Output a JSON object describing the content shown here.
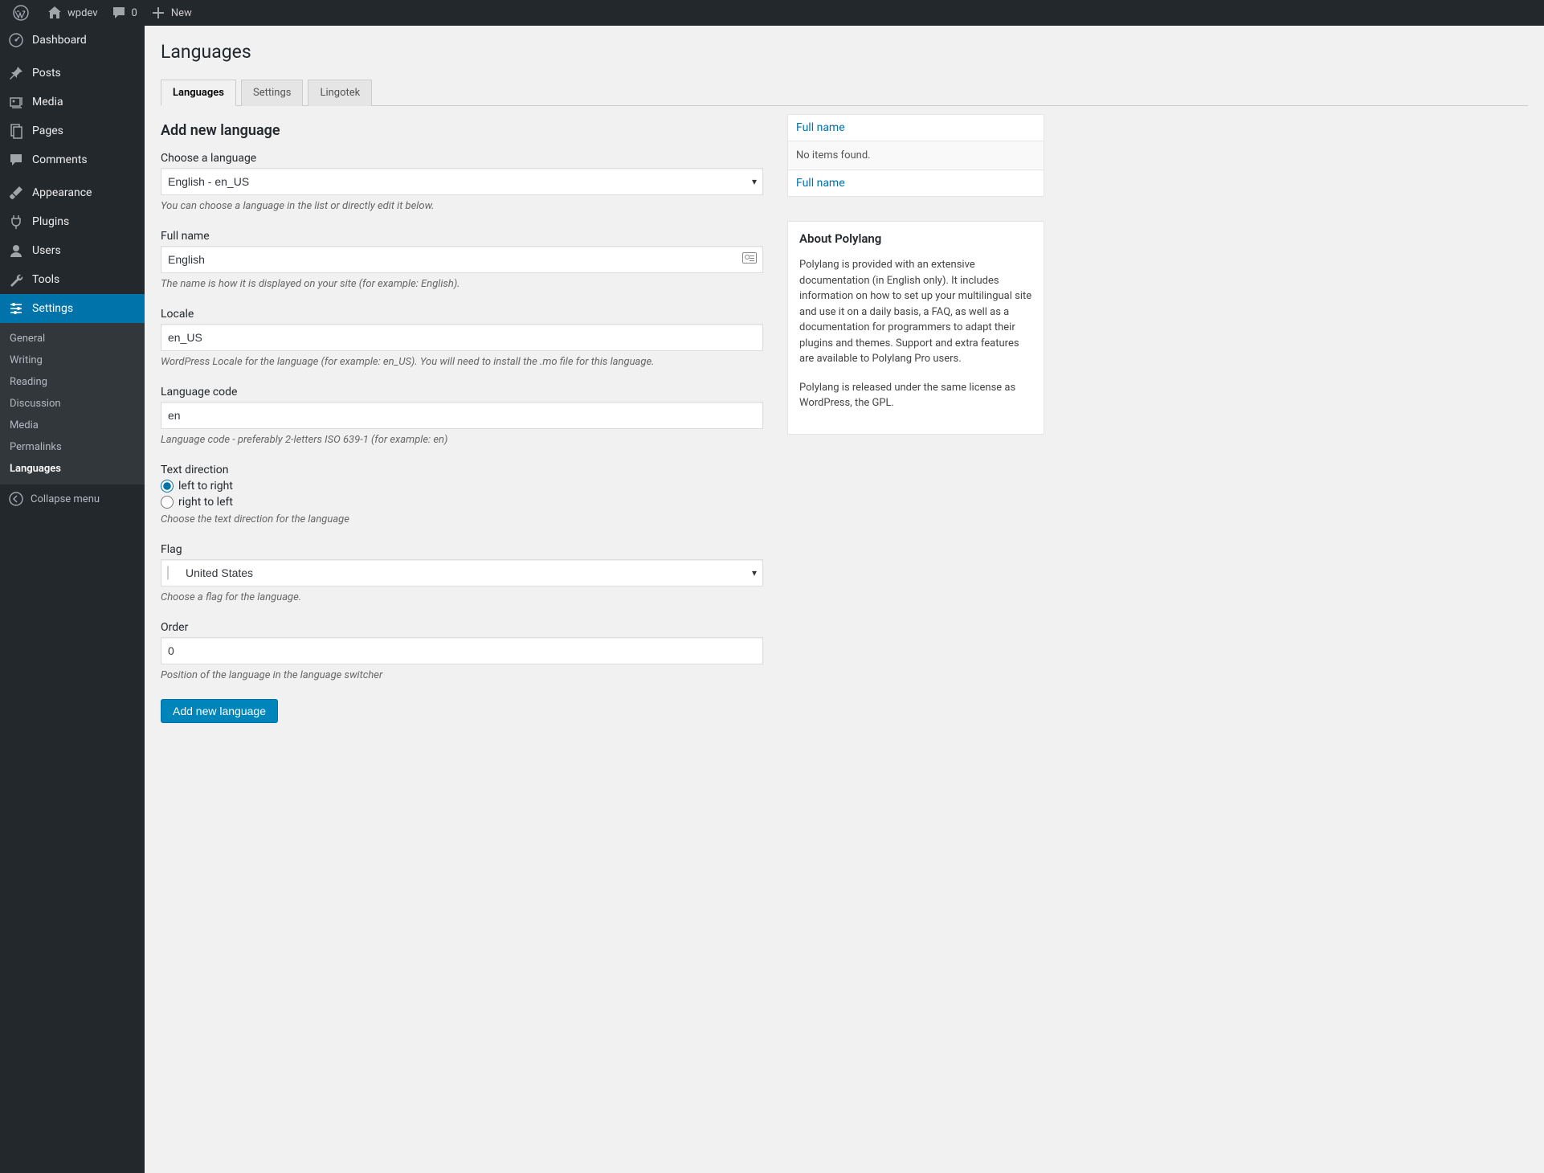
{
  "adminbar": {
    "site_name": "wpdev",
    "comments_count": "0",
    "new_label": "New"
  },
  "sidebar": {
    "items": [
      {
        "label": "Dashboard"
      },
      {
        "label": "Posts"
      },
      {
        "label": "Media"
      },
      {
        "label": "Pages"
      },
      {
        "label": "Comments"
      },
      {
        "label": "Appearance"
      },
      {
        "label": "Plugins"
      },
      {
        "label": "Users"
      },
      {
        "label": "Tools"
      },
      {
        "label": "Settings"
      }
    ],
    "submenu": [
      {
        "label": "General"
      },
      {
        "label": "Writing"
      },
      {
        "label": "Reading"
      },
      {
        "label": "Discussion"
      },
      {
        "label": "Media"
      },
      {
        "label": "Permalinks"
      },
      {
        "label": "Languages"
      }
    ],
    "collapse_label": "Collapse menu"
  },
  "page": {
    "title": "Languages",
    "tabs": [
      {
        "label": "Languages"
      },
      {
        "label": "Settings"
      },
      {
        "label": "Lingotek"
      }
    ],
    "section_title": "Add new language"
  },
  "form": {
    "choose_language": {
      "label": "Choose a language",
      "value": "English - en_US",
      "help": "You can choose a language in the list or directly edit it below."
    },
    "full_name": {
      "label": "Full name",
      "value": "English",
      "help": "The name is how it is displayed on your site (for example: English)."
    },
    "locale": {
      "label": "Locale",
      "value": "en_US",
      "help": "WordPress Locale for the language (for example: en_US). You will need to install the .mo file for this language."
    },
    "language_code": {
      "label": "Language code",
      "value": "en",
      "help": "Language code - preferably 2-letters ISO 639-1 (for example: en)"
    },
    "text_direction": {
      "label": "Text direction",
      "ltr_label": "left to right",
      "rtl_label": "right to left",
      "help": "Choose the text direction for the language"
    },
    "flag": {
      "label": "Flag",
      "value": "United States",
      "help": "Choose a flag for the language."
    },
    "order": {
      "label": "Order",
      "value": "0",
      "help": "Position of the language in the language switcher"
    },
    "submit_label": "Add new language"
  },
  "table": {
    "header_fullname": "Full name",
    "no_items": "No items found.",
    "footer_fullname": "Full name"
  },
  "about": {
    "heading": "About Polylang",
    "p1": "Polylang is provided with an extensive documentation (in English only). It includes information on how to set up your multilingual site and use it on a daily basis, a FAQ, as well as a documentation for programmers to adapt their plugins and themes. Support and extra features are available to Polylang Pro users.",
    "p2": "Polylang is released under the same license as WordPress, the GPL."
  }
}
